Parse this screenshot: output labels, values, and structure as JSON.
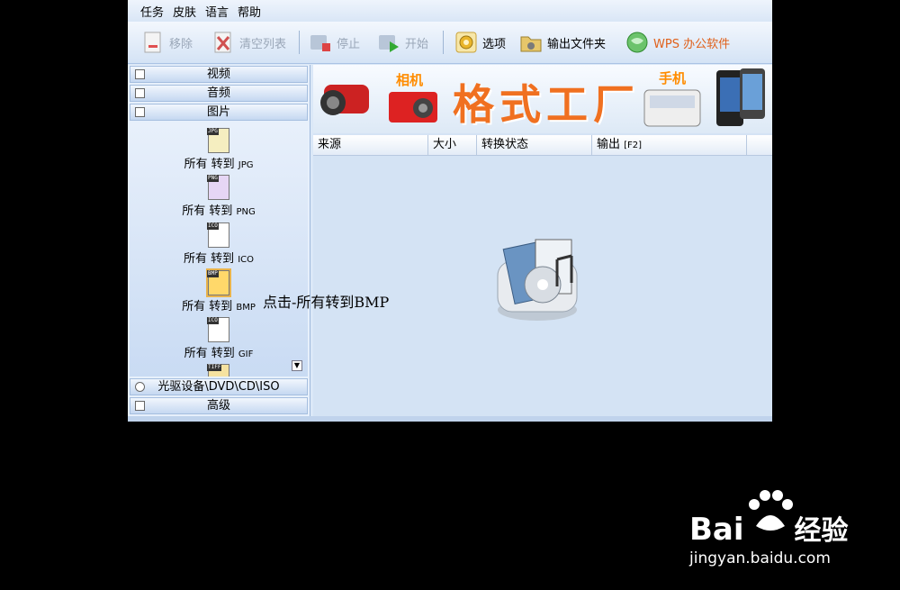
{
  "menu": [
    "任务",
    "皮肤",
    "语言",
    "帮助"
  ],
  "toolbar": {
    "remove": "移除",
    "clear": "清空列表",
    "stop": "停止",
    "start": "开始",
    "options": "选项",
    "output_folder": "输出文件夹",
    "wps": "WPS 办公软件"
  },
  "categories": {
    "video": "视频",
    "audio": "音频",
    "image": "图片",
    "rom": "光驱设备\\DVD\\CD\\ISO",
    "advanced": "高级"
  },
  "items": [
    {
      "label": "所有 转到",
      "fmt": "JPG",
      "tag": "JPG"
    },
    {
      "label": "所有 转到",
      "fmt": "PNG",
      "tag": "PNG"
    },
    {
      "label": "所有 转到",
      "fmt": "ICO",
      "tag": "ICO"
    },
    {
      "label": "所有 转到",
      "fmt": "BMP",
      "tag": "BMP"
    },
    {
      "label": "所有 转到",
      "fmt": "GIF",
      "tag": "ICO"
    },
    {
      "tag": "TIFF"
    }
  ],
  "banner": {
    "title": "格式工厂",
    "camera": "相机",
    "phone": "手机"
  },
  "columns": {
    "source": "来源",
    "size": "大小",
    "status": "转换状态",
    "output": "输出",
    "output_key": "[F2]"
  },
  "note": "点击-所有转到BMP",
  "watermark": {
    "brand": "Bai",
    "brand2": "经验",
    "url": "jingyan.baidu.com"
  }
}
